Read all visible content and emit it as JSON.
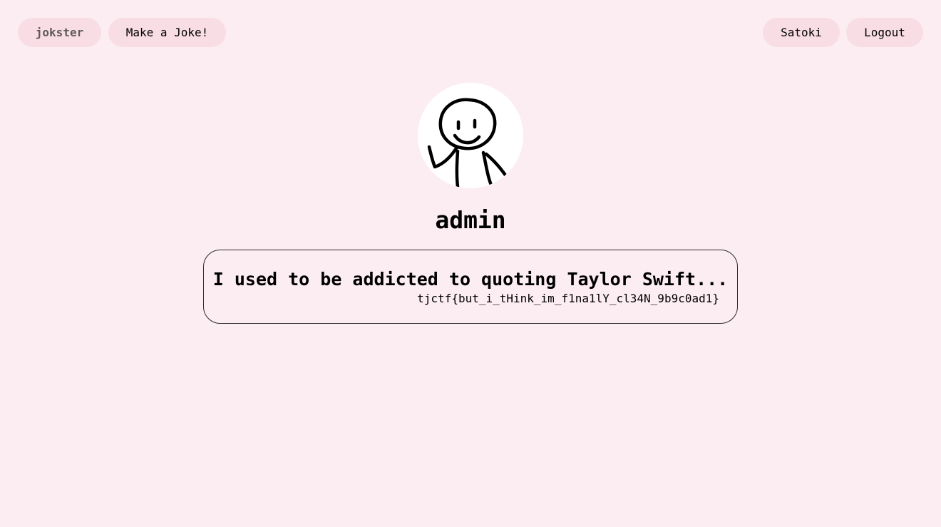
{
  "nav": {
    "brand": "jokster",
    "make_joke": "Make a Joke!",
    "user": "Satoki",
    "logout": "Logout"
  },
  "profile": {
    "username": "admin",
    "avatar_icon": "stick-figure-avatar-icon"
  },
  "jokes": [
    {
      "title": "I used to be addicted to quoting Taylor Swift...",
      "punchline": "tjctf{but_i_tHink_im_f1na1lY_cl34N_9b9c0ad1}"
    }
  ],
  "colors": {
    "background": "#fcedf3",
    "pill": "#f9dde5",
    "brand_text": "#5e5a5b"
  }
}
